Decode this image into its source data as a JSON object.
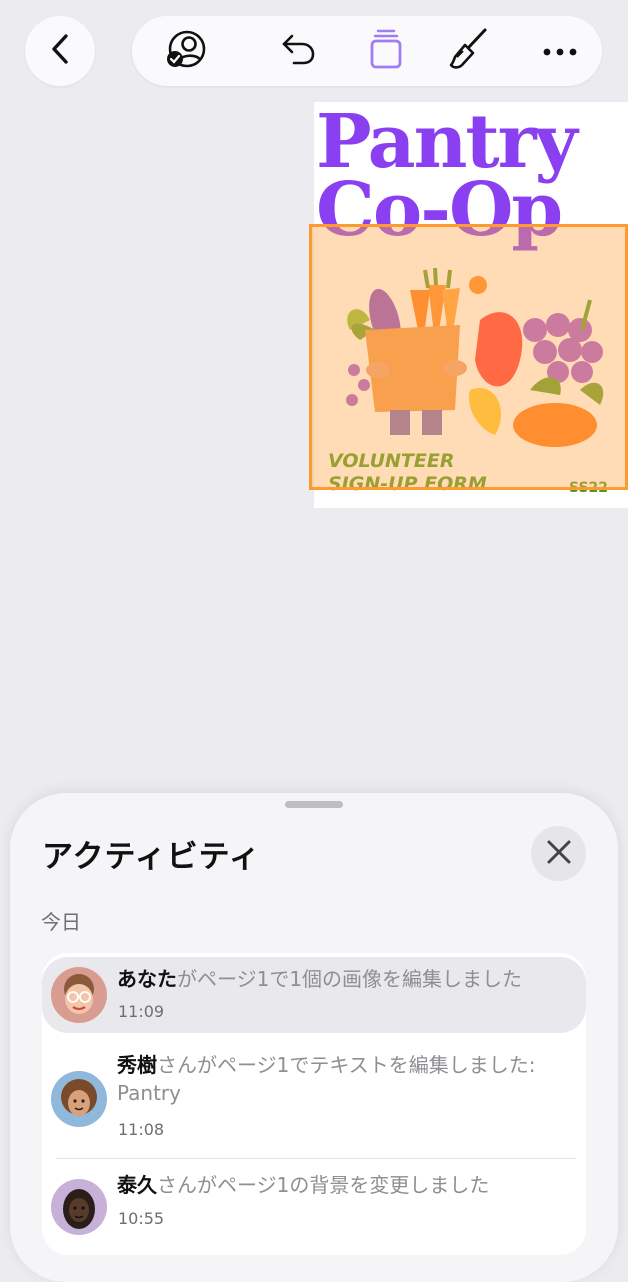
{
  "document": {
    "title_line1": "Pantry",
    "title_line2": "Co-Op",
    "subtitle_line1": "VOLUNTEER",
    "subtitle_line2": "SIGN-UP FORM",
    "code": "SS22"
  },
  "activity": {
    "title": "アクティビティ",
    "section": "今日",
    "items": [
      {
        "who": "あなた",
        "text": "がページ1で1個の画像を編集しました",
        "time": "11:09"
      },
      {
        "who": "秀樹",
        "text": "さんがページ1でテキストを編集しました: Pantry",
        "time": "11:08"
      },
      {
        "who": "泰久",
        "text": "さんがページ1の背景を変更しました",
        "time": "10:55"
      }
    ]
  },
  "colors": {
    "accent_purple": "#8a3ff0",
    "selection_orange": "#ff9a30",
    "green_text": "#4f9a1c"
  },
  "icons": [
    "back-chevron-icon",
    "collaboration-icon",
    "undo-icon",
    "pages-icon",
    "format-brush-icon",
    "more-icon",
    "close-icon"
  ]
}
